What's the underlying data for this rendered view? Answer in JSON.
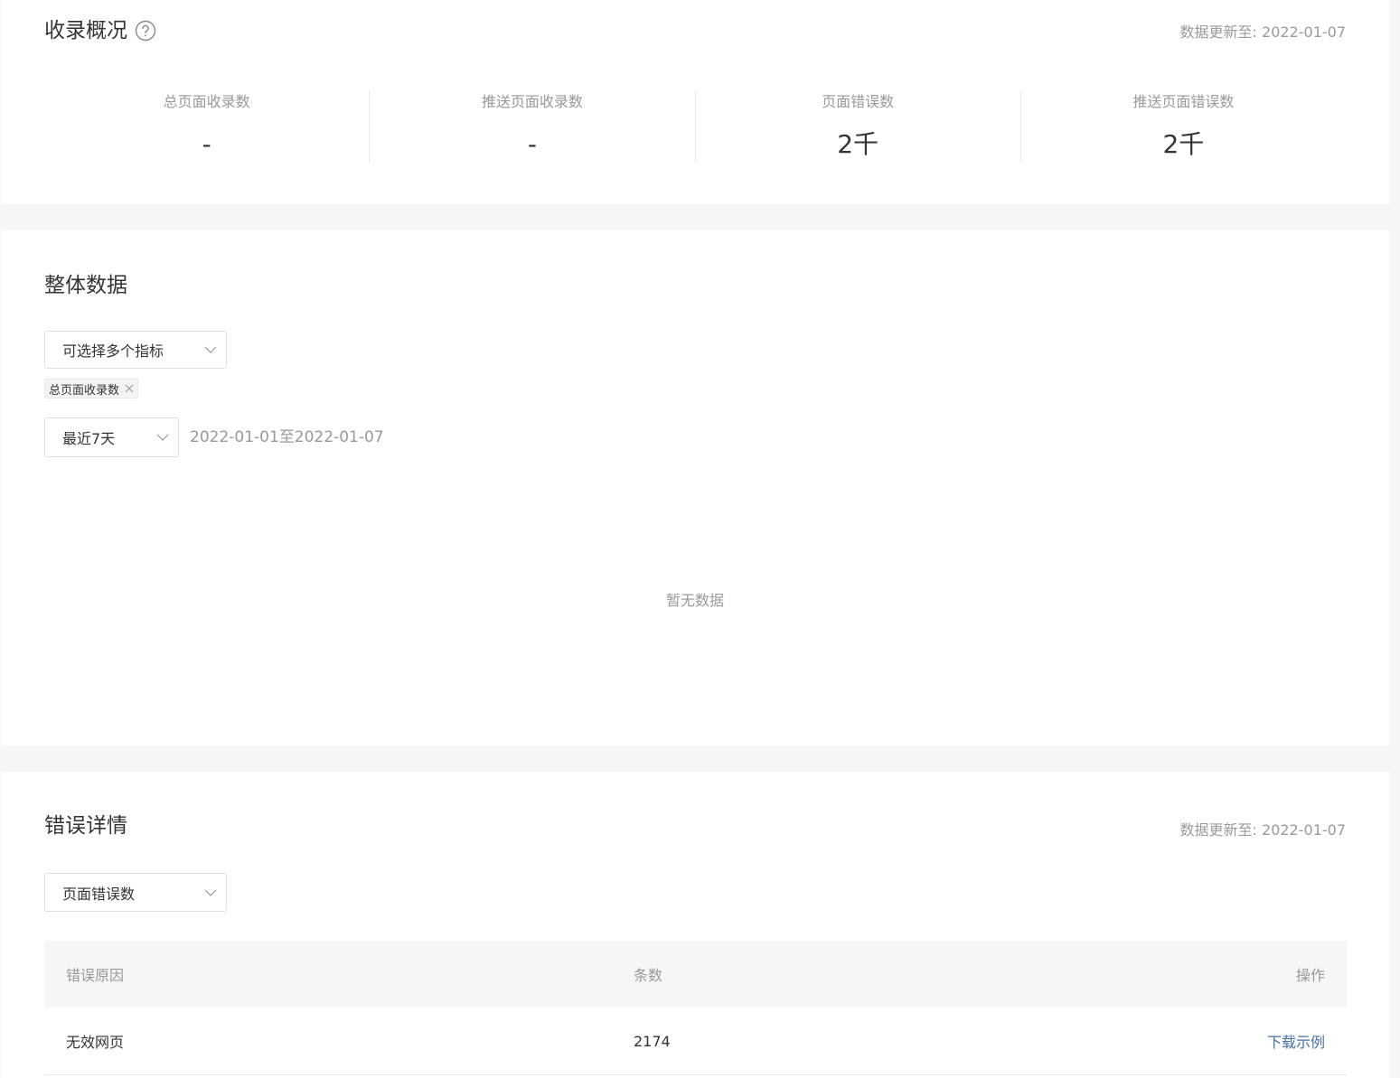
{
  "overview": {
    "title": "收录概况",
    "help_icon": "question-circle-icon",
    "update_label": "数据更新至:",
    "update_date": "2022-01-07",
    "stats": [
      {
        "label": "总页面收录数",
        "value": "-"
      },
      {
        "label": "推送页面收录数",
        "value": "-"
      },
      {
        "label": "页面错误数",
        "value": "2千"
      },
      {
        "label": "推送页面错误数",
        "value": "2千"
      }
    ]
  },
  "overall": {
    "title": "整体数据",
    "metric_select": {
      "placeholder": "可选择多个指标",
      "icon": "chevron-down-icon"
    },
    "selected_tags": [
      {
        "label": "总页面收录数",
        "icon": "close-icon"
      }
    ],
    "period_select": {
      "value": "最近7天",
      "icon": "chevron-down-icon"
    },
    "date_range": "2022-01-01至2022-01-07",
    "empty_text": "暂无数据"
  },
  "errors": {
    "title": "错误详情",
    "update_label": "数据更新至:",
    "update_date": "2022-01-07",
    "type_select": {
      "value": "页面错误数",
      "icon": "chevron-down-icon"
    },
    "table": {
      "headers": [
        "错误原因",
        "条数",
        "操作"
      ],
      "rows": [
        {
          "reason": "无效网页",
          "count": "2174",
          "action": "下载示例"
        }
      ]
    }
  },
  "colors": {
    "background": "#f5f6f8",
    "card": "#ffffff",
    "link": "#4a6fa5",
    "muted": "#999999"
  }
}
